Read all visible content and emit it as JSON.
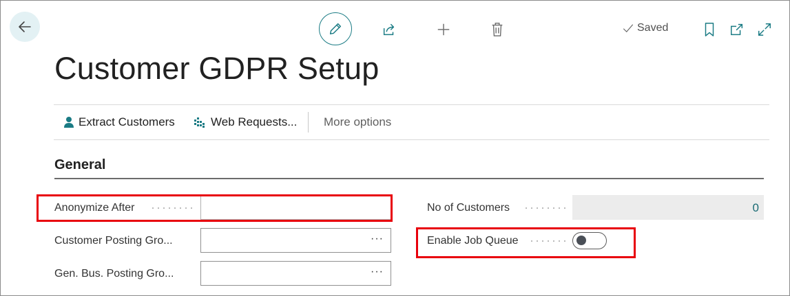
{
  "toolbar": {
    "saved_label": "Saved"
  },
  "page": {
    "title": "Customer GDPR Setup"
  },
  "actions": {
    "extract_customers": "Extract Customers",
    "web_requests": "Web Requests...",
    "more_options": "More options"
  },
  "section": {
    "title": "General"
  },
  "fields": {
    "anonymize_after": {
      "label": "Anonymize After",
      "value": ""
    },
    "customer_posting_group": {
      "label": "Customer Posting Gro...",
      "value": "",
      "ellipsis": "···"
    },
    "gen_bus_posting_group": {
      "label": "Gen. Bus. Posting Gro...",
      "value": "",
      "ellipsis": "···"
    },
    "no_of_customers": {
      "label": "No of Customers",
      "value": "0"
    },
    "enable_job_queue": {
      "label": "Enable Job Queue",
      "value": false
    }
  },
  "colors": {
    "accent": "#1a7b84",
    "highlight": "#e8000b"
  }
}
